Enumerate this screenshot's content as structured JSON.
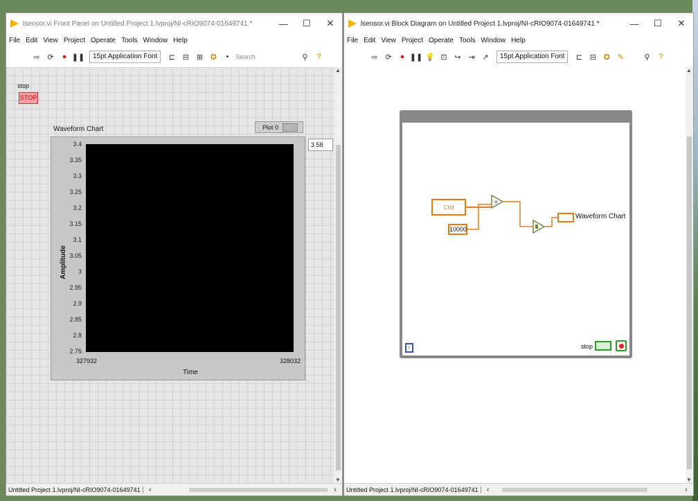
{
  "front_panel": {
    "title": "lsensor.vi Front Panel on Untitled Project 1.lvproj/NI-cRIO9074-01649741 *",
    "menu": [
      "File",
      "Edit",
      "View",
      "Project",
      "Operate",
      "Tools",
      "Window",
      "Help"
    ],
    "font_select": "15pt Application Font",
    "search_placeholder": "Search",
    "stop": {
      "label": "stop",
      "button_text": "STOP"
    },
    "chart": {
      "title": "Waveform Chart",
      "plot_legend": "Plot 0",
      "digital_display": "3.58",
      "y_ticks": [
        "3.4",
        "3.35",
        "3.3",
        "3.25",
        "3.2",
        "3.15",
        "3.1",
        "3.05",
        "3",
        "2.95",
        "2.9",
        "2.85",
        "2.8",
        "2.75"
      ],
      "y_label": "Amplitude",
      "x_start": "327932",
      "x_end": "328032",
      "x_label": "Time"
    },
    "status_text": "Untitled Project 1.lvproj/NI-cRIO9074-01649741"
  },
  "block_diagram": {
    "title": "lsensor.vi Block Diagram on Untitled Project 1.lvproj/NI-cRIO9074-01649741 *",
    "menu": [
      "File",
      "Edit",
      "View",
      "Project",
      "Operate",
      "Tools",
      "Window",
      "Help"
    ],
    "font_select": "15pt Application Font",
    "daq_label": "Ch0",
    "constant_value": "10000",
    "chart_terminal_label": "Waveform Chart",
    "stop_terminal_label": "stop",
    "iteration_label": "i",
    "status_text": "Untitled Project 1.lvproj/NI-cRIO9074-01649741"
  },
  "window_controls": {
    "minimize": "—",
    "maximize": "☐",
    "close": "✕"
  },
  "chart_data": {
    "type": "line",
    "title": "Waveform Chart",
    "xlabel": "Time",
    "ylabel": "Amplitude",
    "xlim": [
      327932,
      328032
    ],
    "ylim": [
      2.75,
      3.4
    ],
    "series": []
  }
}
